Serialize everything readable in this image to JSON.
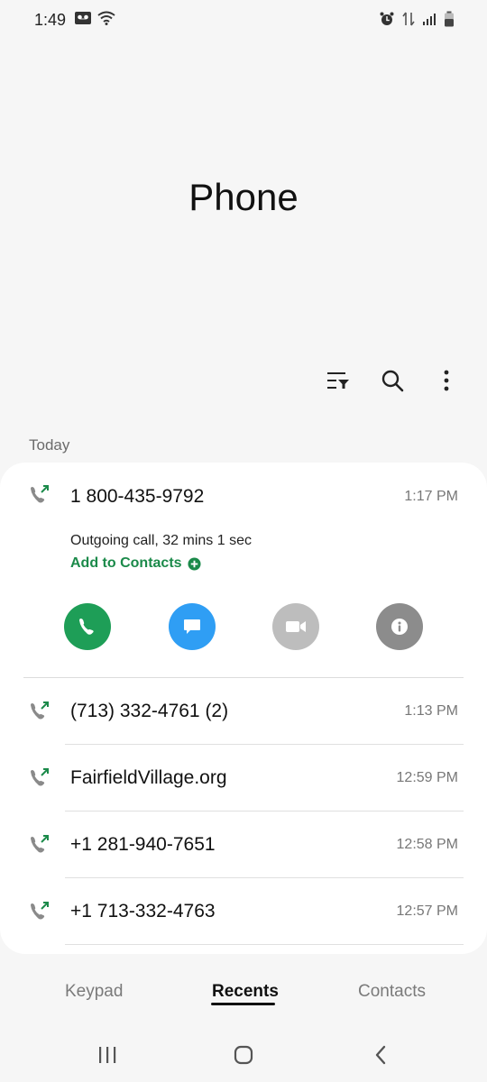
{
  "status": {
    "time": "1:49",
    "left_icons": [
      "voicemail-icon",
      "wifi-icon"
    ],
    "right_icons": [
      "alarm-icon",
      "data-icon",
      "signal-icon",
      "battery-icon"
    ]
  },
  "header": {
    "title": "Phone"
  },
  "toolbar": {
    "icons": [
      "filter-icon",
      "search-icon",
      "more-icon"
    ]
  },
  "section": {
    "label": "Today"
  },
  "expanded": {
    "number": "1 800-435-9792",
    "time": "1:17 PM",
    "detail": "Outgoing call, 32 mins 1 sec",
    "add_contacts": "Add to Contacts",
    "actions": [
      {
        "name": "call",
        "color": "#1e9e57"
      },
      {
        "name": "message",
        "color": "#2f9ef4"
      },
      {
        "name": "video",
        "color": "#bdbdbd"
      },
      {
        "name": "info",
        "color": "#8c8c8c"
      }
    ]
  },
  "calls": [
    {
      "number": "(713) 332-4761 (2)",
      "time": "1:13 PM"
    },
    {
      "number": "FairfieldVillage.org",
      "time": "12:59 PM"
    },
    {
      "number": "+1 281-940-7651",
      "time": "12:58 PM"
    },
    {
      "number": "+1 713-332-4763",
      "time": "12:57 PM"
    }
  ],
  "tabs": [
    {
      "label": "Keypad",
      "active": false
    },
    {
      "label": "Recents",
      "active": true
    },
    {
      "label": "Contacts",
      "active": false
    }
  ],
  "colors": {
    "accent_green": "#1b8a4a",
    "outgoing_arrow": "#1b8a4a"
  }
}
